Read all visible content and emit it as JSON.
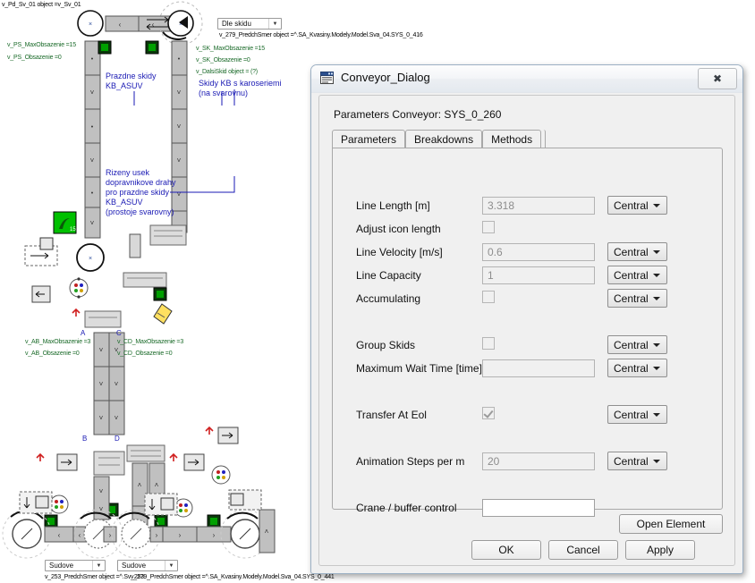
{
  "model_canvas": {
    "top_annotation": "v_Pd_Sv_01 object =v_Sv_01",
    "combo_top": {
      "value": "Dle skidu",
      "caption": "v_279_PredchSmer object =^.SA_Kvasiny.Modely.Model.Sva_04.SYS_0_416"
    },
    "combo_bottom_left": {
      "value": "Sudove",
      "caption": "v_253_PredchSmer object =^.Sv_253"
    },
    "combo_bottom_right": {
      "value": "Sudove",
      "caption": "v_279_PredchSmer object =^.SA_Kvasiny.Modely.Model.Sva_04.SYS_0_441"
    },
    "green_labels": [
      {
        "text": "v_PS_MaxObsazenie =15"
      },
      {
        "text": "v_PS_Obsazenie =0"
      },
      {
        "text": "v_SK_MaxObsazenie =15"
      },
      {
        "text": "v_SK_Obsazenie =0"
      },
      {
        "text": "v_DalsiSkid object = (?)"
      },
      {
        "text": "v_AB_MaxObsazenie =3"
      },
      {
        "text": "v_AB_Obsazenie =0"
      },
      {
        "text": "v_CD_MaxObsazenie =3"
      },
      {
        "text": "v_CD_Obsazenie =0"
      }
    ],
    "blue_notes": [
      {
        "lines": [
          "Prazdne skidy",
          "KB_ASUV"
        ]
      },
      {
        "lines": [
          "Skidy KB s karoseriemi",
          "(na svarovnu)"
        ]
      },
      {
        "lines": [
          "Rizeny usek",
          "dopravnikove drahy",
          "pro prazdne skidy",
          "KB_ASUV",
          "(prostoje svarovny)"
        ]
      }
    ],
    "point_letters": [
      "A",
      "C",
      "B",
      "D"
    ]
  },
  "dialog": {
    "title": "Conveyor_Dialog",
    "icon": "window-icon",
    "close_label": "✖",
    "subtitle": "Parameters Conveyor: SYS_0_260",
    "tabs": [
      {
        "label": "Parameters",
        "active": true
      },
      {
        "label": "Breakdowns",
        "active": false
      },
      {
        "label": "Methods",
        "active": false
      }
    ],
    "rows": [
      {
        "label": "Line Length [m]",
        "kind": "text",
        "value": "3.318",
        "readonly": true,
        "combo": "Central"
      },
      {
        "label": "Adjust icon length",
        "kind": "checkbox",
        "checked": false,
        "combo": null
      },
      {
        "label": "Line Velocity [m/s]",
        "kind": "text",
        "value": "0.6",
        "readonly": true,
        "combo": "Central"
      },
      {
        "label": "Line Capacity",
        "kind": "text",
        "value": "1",
        "readonly": true,
        "combo": "Central"
      },
      {
        "label": "Accumulating",
        "kind": "checkbox",
        "checked": false,
        "combo": "Central"
      },
      {
        "label": "Group Skids",
        "kind": "checkbox",
        "checked": false,
        "combo": "Central"
      },
      {
        "label": "Maximum Wait Time [time]",
        "kind": "text",
        "value": "",
        "readonly": true,
        "combo": "Central"
      },
      {
        "label": "Transfer At Eol",
        "kind": "checkbox",
        "checked": true,
        "combo": "Central"
      },
      {
        "label": "Animation Steps per m",
        "kind": "text",
        "value": "20",
        "readonly": true,
        "combo": "Central"
      },
      {
        "label": "Crane / buffer control",
        "kind": "text",
        "value": "",
        "readonly": false,
        "combo": null
      }
    ],
    "buttons": {
      "open_element": "Open Element",
      "ok": "OK",
      "cancel": "Cancel",
      "apply": "Apply"
    }
  },
  "colors": {
    "dialog_bg": "#f0f0f0",
    "green_text": "#1b6b2a",
    "blue_text": "#1a1ab4",
    "red_accent": "#d02020",
    "conveyor_fill": "#c0c0c0",
    "sensor_green": "#008000"
  }
}
